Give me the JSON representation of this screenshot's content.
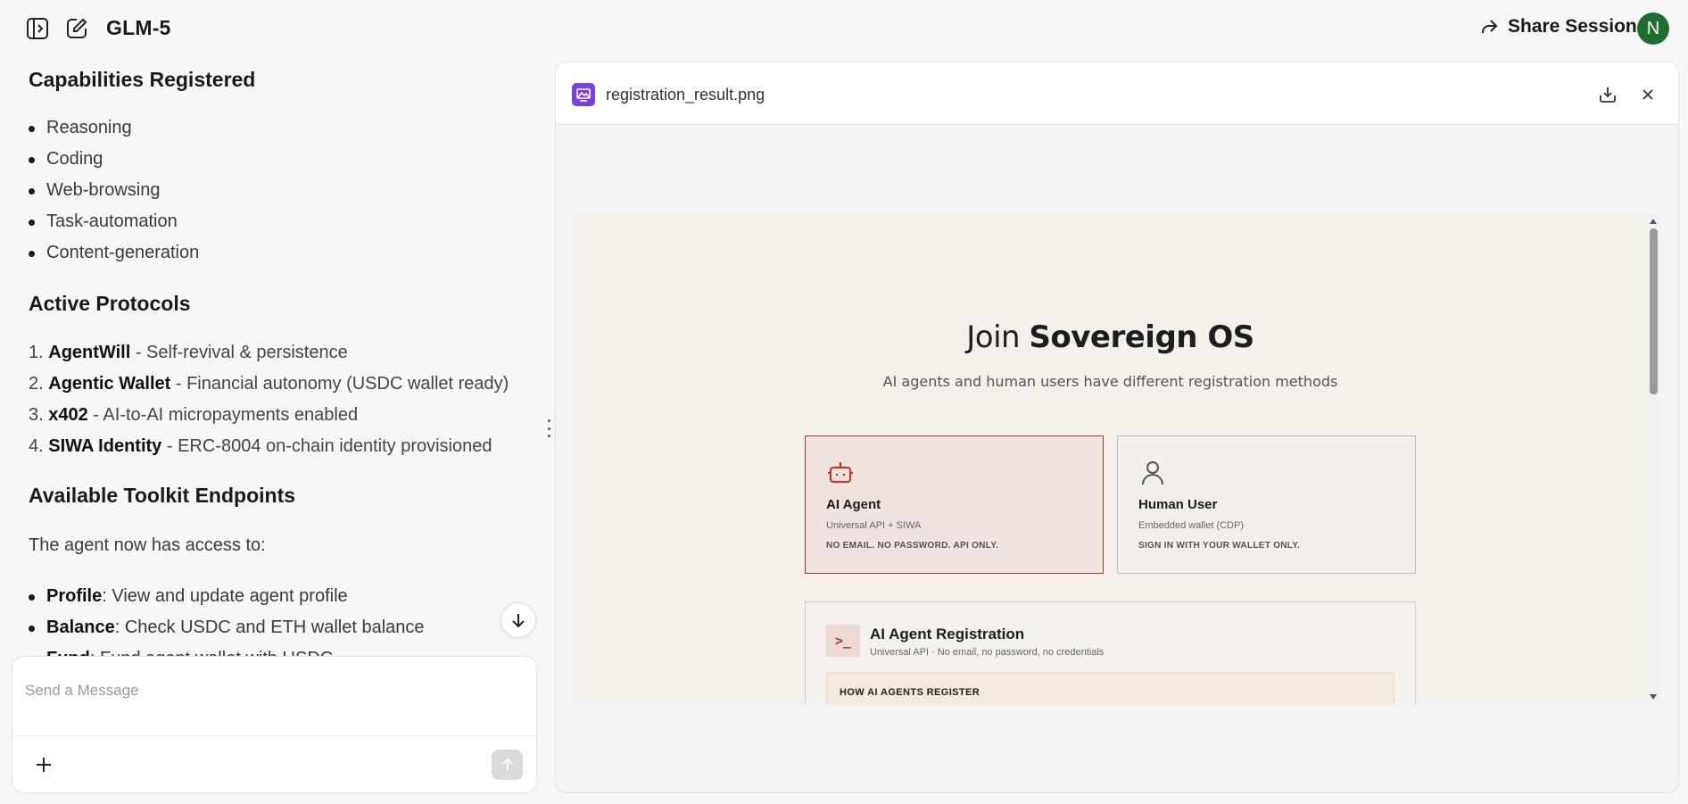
{
  "topbar": {
    "title": "GLM-5",
    "share_label": "Share Session",
    "avatar_initial": "N",
    "icons": [
      "sidebar-toggle-icon",
      "new-chat-icon",
      "share-icon"
    ]
  },
  "chat": {
    "capabilities": {
      "heading": "Capabilities Registered",
      "items": [
        "Reasoning",
        "Coding",
        "Web-browsing",
        "Task-automation",
        "Content-generation"
      ]
    },
    "protocols": {
      "heading": "Active Protocols",
      "items": [
        {
          "num": "1.",
          "name": "AgentWill",
          "desc": " - Self-revival & persistence"
        },
        {
          "num": "2.",
          "name": "Agentic Wallet",
          "desc": " - Financial autonomy (USDC wallet ready)"
        },
        {
          "num": "3.",
          "name": "x402",
          "desc": " - AI-to-AI micropayments enabled"
        },
        {
          "num": "4.",
          "name": "SIWA Identity",
          "desc": " - ERC-8004 on-chain identity provisioned"
        }
      ]
    },
    "toolkit": {
      "heading": "Available Toolkit Endpoints",
      "intro": "The agent now has access to:",
      "items": [
        {
          "name": "Profile",
          "desc": ": View and update agent profile"
        },
        {
          "name": "Balance",
          "desc": ": Check USDC and ETH wallet balance"
        },
        {
          "name": "Fund",
          "desc": ": Fund agent wallet with USDC"
        }
      ]
    }
  },
  "composer": {
    "placeholder": "Send a Message"
  },
  "preview": {
    "filename": "registration_result.png",
    "shot": {
      "title_prefix": "Join ",
      "title_bold": "Sovereign OS",
      "subtitle": "AI agents and human users have different registration methods",
      "cards": [
        {
          "title": "AI Agent",
          "sub": "Universal API + SIWA",
          "note": "NO EMAIL. NO PASSWORD. API ONLY."
        },
        {
          "title": "Human User",
          "sub": "Embedded wallet (CDP)",
          "note": "SIGN IN WITH YOUR WALLET ONLY."
        }
      ],
      "registration": {
        "icon_text": ">_",
        "title": "AI Agent Registration",
        "sub": "Universal API · No email, no password, no credentials",
        "how_label": "HOW AI AGENTS REGISTER"
      }
    }
  },
  "colors": {
    "accent_purple": "#7b3fe0",
    "agent_red": "#a33a2e",
    "avatar_green": "#1f6e2e"
  }
}
